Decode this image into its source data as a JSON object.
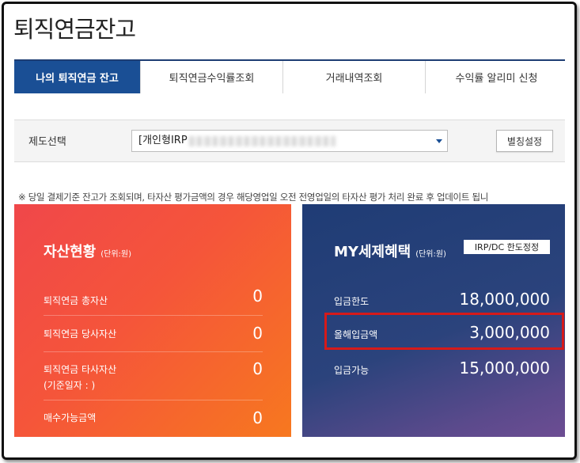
{
  "page": {
    "title": "퇴직연금잔고"
  },
  "tabs": [
    {
      "label": "나의 퇴직연금 잔고",
      "active": true
    },
    {
      "label": "퇴직연금수익률조회"
    },
    {
      "label": "거래내역조회"
    },
    {
      "label": "수익률 알리미 신청"
    }
  ],
  "selector": {
    "label": "제도선택",
    "value": "[개인형IRP",
    "alias_button": "별칭설정"
  },
  "notice": "※ 당일 결제기준 잔고가 조회되며, 타자산 평가금액의 경우 해당영업일 오전 전영업일의 타자산 평가 처리 완료 후 업데이트 됩니",
  "assets": {
    "title": "자산현황",
    "unit": "(단위:원)",
    "rows": [
      {
        "label": "퇴직연금 총자산",
        "value": "0"
      },
      {
        "label": "퇴직연금 당사자산",
        "value": "0"
      },
      {
        "label": "퇴직연금 타사자산",
        "sub": "(기준일자 : )",
        "value": "0"
      },
      {
        "label": "매수가능금액",
        "value": "0"
      }
    ]
  },
  "tax": {
    "title": "MY세제혜택",
    "unit": "(단위:원)",
    "badge": "IRP/DC 한도정정",
    "rows": [
      {
        "label": "입금한도",
        "value": "18,000,000"
      },
      {
        "label": "올해입금액",
        "value": "3,000,000"
      },
      {
        "label": "입금가능",
        "value": "15,000,000"
      }
    ]
  },
  "colors": {
    "tab_active": "#1a4f95",
    "asset_card_start": "#f0474a",
    "asset_card_end": "#f7781f",
    "tax_card_start": "#1f3c75",
    "tax_card_end": "#6d4d93",
    "highlight": "#d61a1a"
  }
}
